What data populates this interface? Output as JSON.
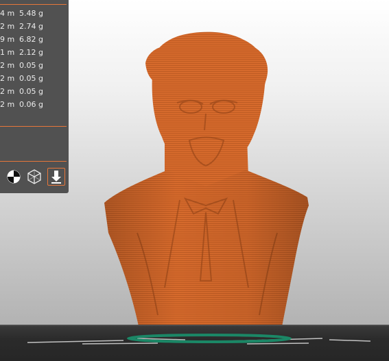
{
  "stats": {
    "rows": [
      {
        "length": "4 m",
        "weight": "5.48 g"
      },
      {
        "length": "2 m",
        "weight": "2.74 g"
      },
      {
        "length": "9 m",
        "weight": "6.82 g"
      },
      {
        "length": "1 m",
        "weight": "2.12 g"
      },
      {
        "length": "2 m",
        "weight": "0.05 g"
      },
      {
        "length": "2 m",
        "weight": "0.05 g"
      },
      {
        "length": "2 m",
        "weight": "0.05 g"
      },
      {
        "length": "2 m",
        "weight": "0.06 g"
      }
    ]
  },
  "toolbar": {
    "buttons": [
      {
        "icon": "balance-icon"
      },
      {
        "icon": "cube-icon"
      },
      {
        "icon": "export-gcode-icon"
      }
    ]
  },
  "colors": {
    "accent": "#e8773a",
    "model": "#d2692e",
    "panel": "#515151",
    "skirt": "#1f8a6a"
  }
}
